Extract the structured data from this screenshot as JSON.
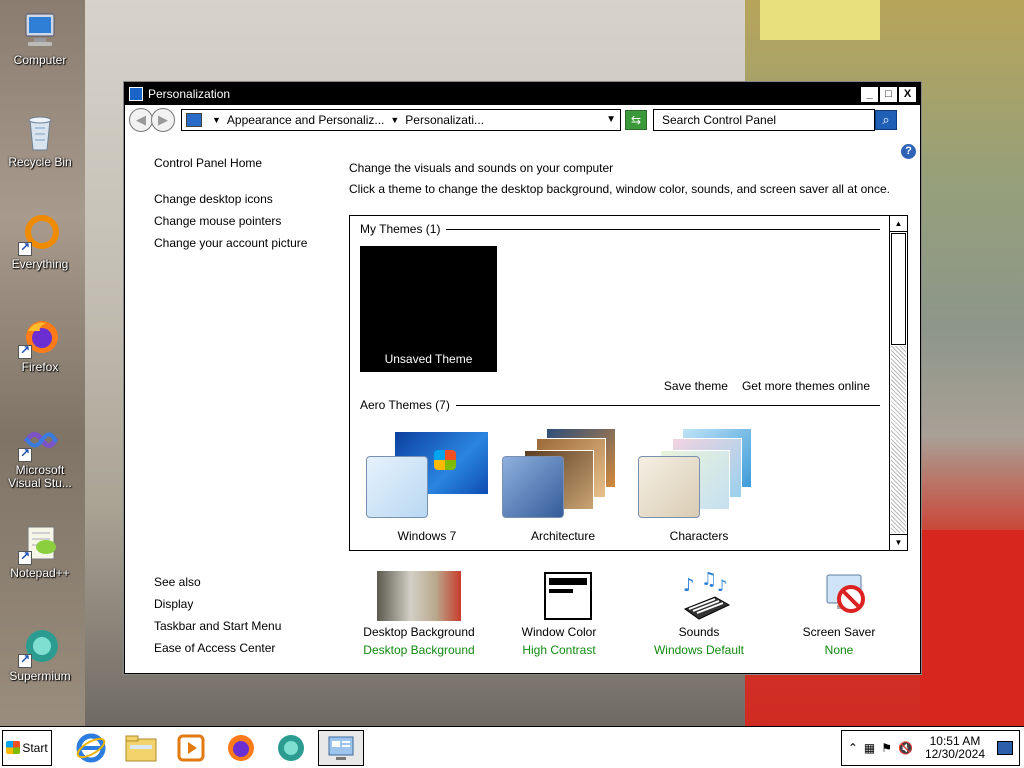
{
  "desktop": {
    "icons": [
      {
        "label": "Computer"
      },
      {
        "label": "Recycle Bin"
      },
      {
        "label": "Everything"
      },
      {
        "label": "Firefox"
      },
      {
        "label": "Microsoft Visual Stu..."
      },
      {
        "label": "Notepad++"
      },
      {
        "label": "Supermium"
      }
    ]
  },
  "window": {
    "title": "Personalization",
    "controls": {
      "minimize": "_",
      "maximize": "□",
      "close": "X"
    },
    "nav": {
      "breadcrumb": [
        "Appearance and Personaliz...",
        "Personalizati..."
      ],
      "search_placeholder": "Search Control Panel"
    },
    "help": "?",
    "left_links": {
      "home": "Control Panel Home",
      "items": [
        "Change desktop icons",
        "Change mouse pointers",
        "Change your account picture"
      ]
    },
    "see_also": {
      "title": "See also",
      "items": [
        "Display",
        "Taskbar and Start Menu",
        "Ease of Access Center"
      ]
    },
    "main": {
      "heading": "Change the visuals and sounds on your computer",
      "subheading": "Click a theme to change the desktop background, window color, sounds, and screen saver all at once.",
      "my_themes": {
        "title": "My Themes (1)",
        "items": [
          {
            "label": "Unsaved Theme"
          }
        ]
      },
      "actions": {
        "save": "Save theme",
        "more": "Get more themes online"
      },
      "aero_themes": {
        "title": "Aero Themes (7)",
        "items": [
          {
            "label": "Windows 7"
          },
          {
            "label": "Architecture"
          },
          {
            "label": "Characters"
          }
        ]
      }
    },
    "bottom": [
      {
        "title": "Desktop Background",
        "value": "Desktop Background"
      },
      {
        "title": "Window Color",
        "value": "High Contrast"
      },
      {
        "title": "Sounds",
        "value": "Windows Default"
      },
      {
        "title": "Screen Saver",
        "value": "None"
      }
    ]
  },
  "taskbar": {
    "start_label": "Start",
    "clock": {
      "time": "10:51 AM",
      "date": "12/30/2024"
    }
  }
}
